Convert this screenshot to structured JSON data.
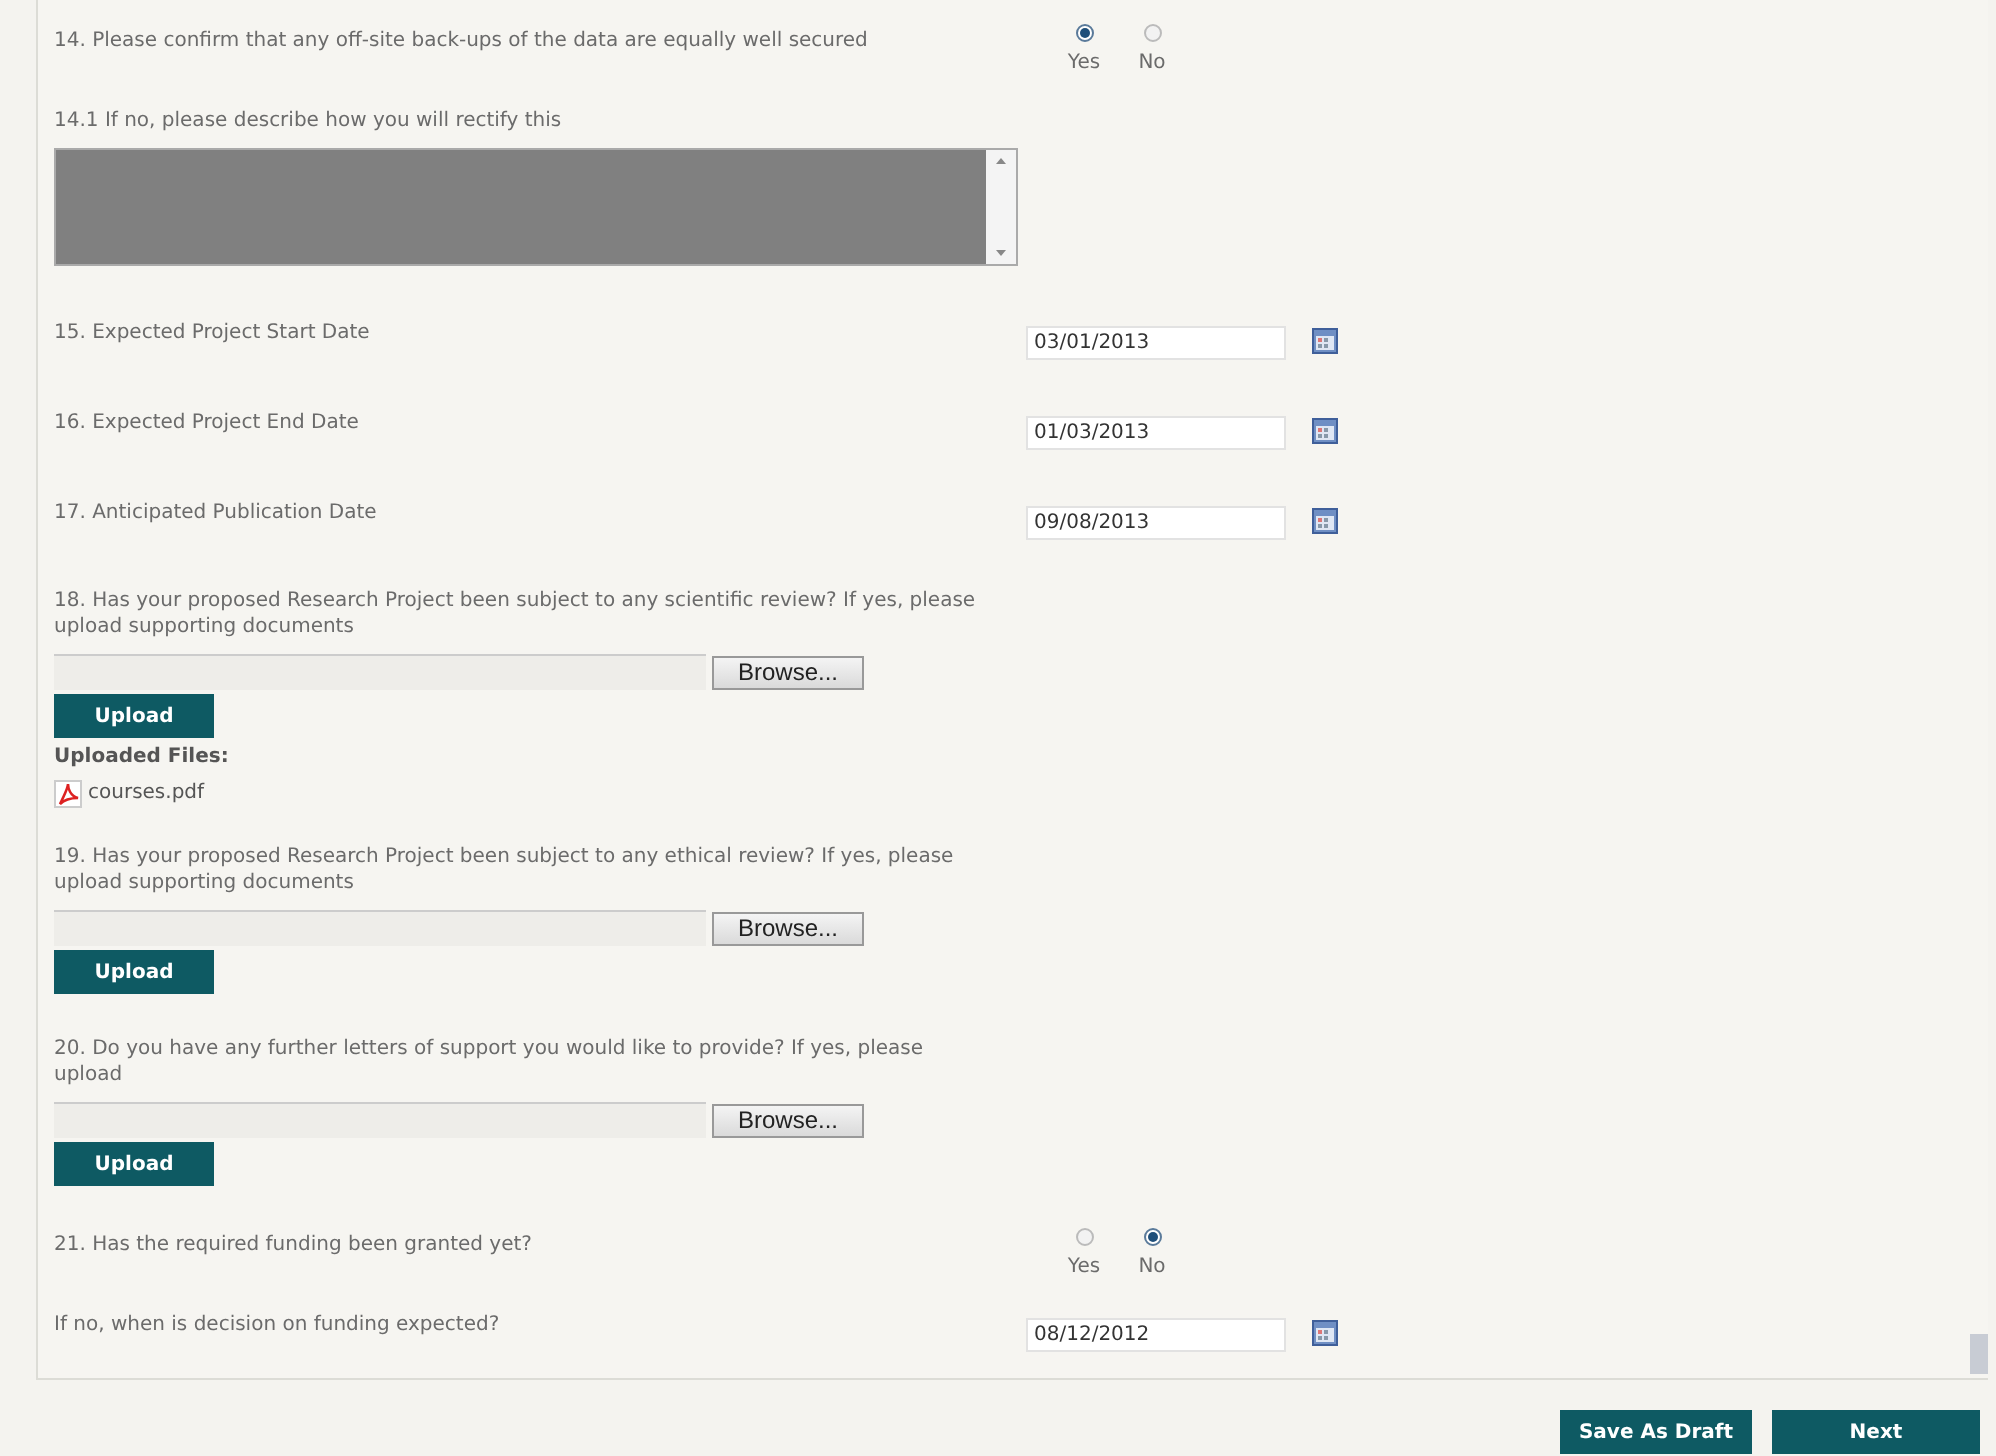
{
  "items": [
    {
      "kind": "radio",
      "label": "14. Please confirm that any off-site back-ups of the data are equally well secured",
      "options": [
        {
          "label": "Yes",
          "selected": true
        },
        {
          "label": "No",
          "selected": false
        }
      ]
    },
    {
      "kind": "textarea",
      "label": "14.1 If no, please describe how you will rectify this"
    },
    {
      "kind": "date",
      "label": "15. Expected Project Start Date",
      "value": "03/01/2013"
    },
    {
      "kind": "date",
      "label": "16. Expected Project End Date",
      "value": "01/03/2013"
    },
    {
      "kind": "date",
      "label": "17. Anticipated Publication Date",
      "value": "09/08/2013"
    },
    {
      "kind": "upload",
      "label": "18. Has your proposed Research Project been subject to any scientific review? If yes, please upload supporting documents",
      "browse": "Browse...",
      "upload": "Upload",
      "uploaded_heading": "Uploaded Files:",
      "files": [
        {
          "name": "courses.pdf"
        }
      ]
    },
    {
      "kind": "upload",
      "label": "19. Has your proposed Research Project been subject to any ethical review? If yes, please upload supporting documents",
      "browse": "Browse...",
      "upload": "Upload"
    },
    {
      "kind": "upload",
      "label": "20. Do you have any further letters of support you would like to provide? If yes, please upload",
      "browse": "Browse...",
      "upload": "Upload"
    },
    {
      "kind": "radio",
      "label": "21. Has the required funding been granted yet?",
      "options": [
        {
          "label": "Yes",
          "selected": false
        },
        {
          "label": "No",
          "selected": true
        }
      ]
    },
    {
      "kind": "date",
      "label": "If no, when is decision on funding expected?",
      "value": "08/12/2012"
    }
  ],
  "buttons": [
    {
      "label": "Save As Draft"
    },
    {
      "label": "Next"
    }
  ]
}
